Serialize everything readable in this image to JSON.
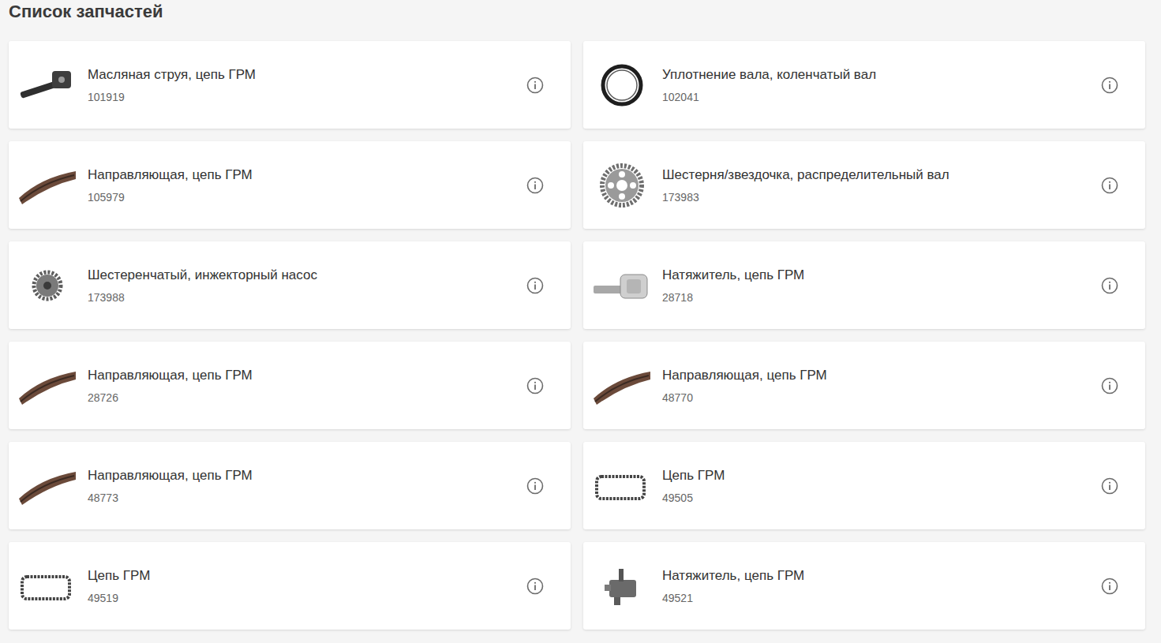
{
  "title": "Список запчастей",
  "parts": [
    {
      "name": "Масляная струя, цепь ГРМ",
      "number": "101919",
      "kind": "jet"
    },
    {
      "name": "Уплотнение вала, коленчатый вал",
      "number": "102041",
      "kind": "seal"
    },
    {
      "name": "Направляющая, цепь ГРМ",
      "number": "105979",
      "kind": "guide"
    },
    {
      "name": "Шестерня/звездочка, распределительный вал",
      "number": "173983",
      "kind": "gear"
    },
    {
      "name": "Шестеренчатый, инжекторный насос",
      "number": "173988",
      "kind": "pumpgear"
    },
    {
      "name": "Натяжитель, цепь ГРМ",
      "number": "28718",
      "kind": "tensioner"
    },
    {
      "name": "Направляющая, цепь ГРМ",
      "number": "28726",
      "kind": "guide"
    },
    {
      "name": "Направляющая, цепь ГРМ",
      "number": "48770",
      "kind": "guide"
    },
    {
      "name": "Направляющая, цепь ГРМ",
      "number": "48773",
      "kind": "guide"
    },
    {
      "name": "Цепь ГРМ",
      "number": "49505",
      "kind": "chain"
    },
    {
      "name": "Цепь ГРМ",
      "number": "49519",
      "kind": "chain"
    },
    {
      "name": "Натяжитель, цепь ГРМ",
      "number": "49521",
      "kind": "block"
    }
  ]
}
